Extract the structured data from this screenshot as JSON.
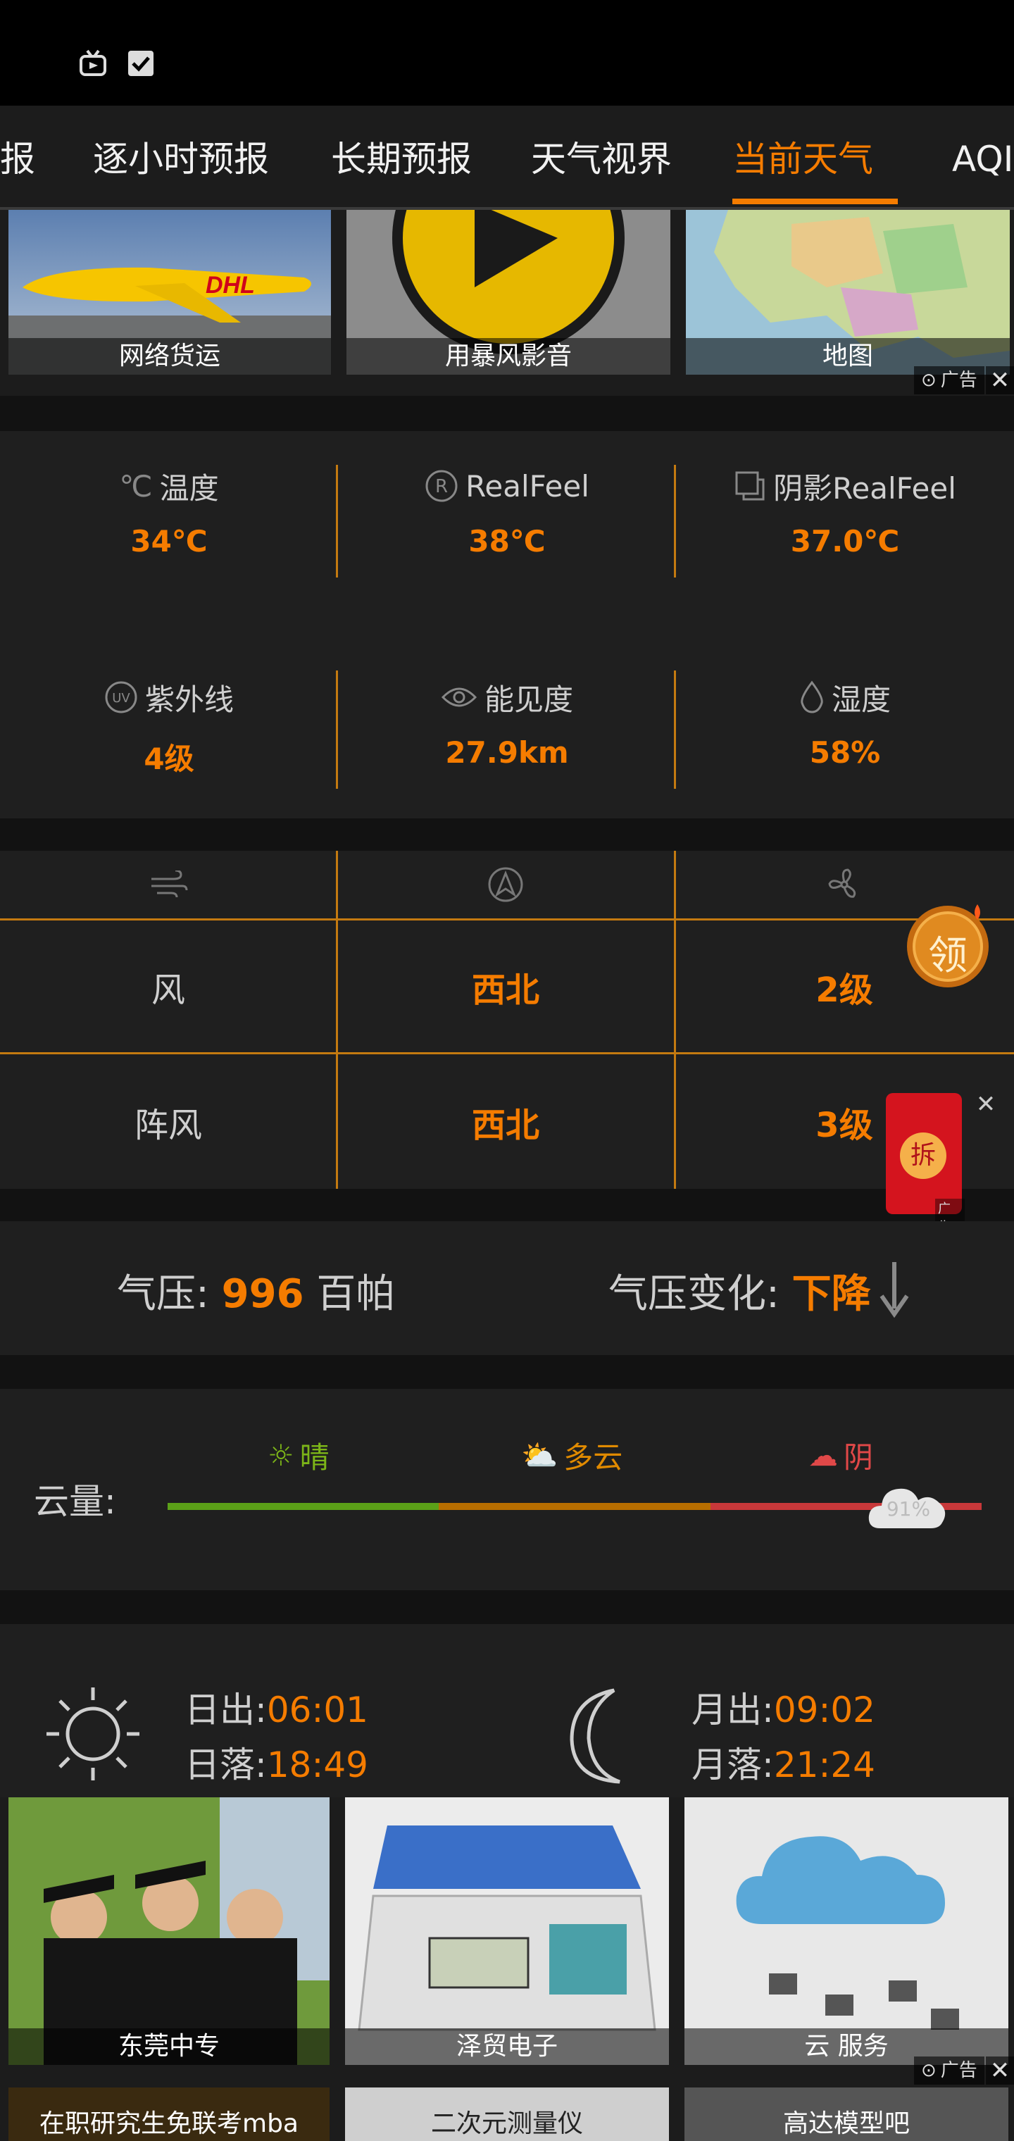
{
  "tabs": [
    "报",
    "逐小时预报",
    "长期预报",
    "天气视界",
    "当前天气",
    "AQI"
  ],
  "active_tab": "当前天气",
  "ads_top": {
    "tiles": [
      "网络货运",
      "用暴风影音",
      "地图"
    ],
    "badge": "广告"
  },
  "metrics": {
    "temperature": {
      "label": "温度",
      "value": "34℃"
    },
    "realfeel": {
      "label": "RealFeel",
      "value": "38℃"
    },
    "shade_realfeel": {
      "label": "阴影RealFeel",
      "value": "37.0℃"
    },
    "uv": {
      "label": "紫外线",
      "value": "4级"
    },
    "visibility": {
      "label": "能见度",
      "value": "27.9km"
    },
    "humidity": {
      "label": "湿度",
      "value": "58%"
    }
  },
  "wind": {
    "rows": [
      {
        "label": "风",
        "direction": "西北",
        "level": "2级"
      },
      {
        "label": "阵风",
        "direction": "西北",
        "level": "3级"
      }
    ],
    "floating_coin": "领",
    "red_packet": "拆",
    "red_packet_badge": "广告"
  },
  "pressure": {
    "label": "气压: ",
    "value": "996",
    "unit": " 百帕",
    "change_label": "气压变化: ",
    "change_value": "下降"
  },
  "cloud": {
    "label": "云量:",
    "levels": [
      "晴",
      "多云",
      "阴"
    ],
    "value": "91%",
    "value_fraction": 0.91
  },
  "sun_moon": {
    "sunrise_label": "日出:",
    "sunrise": "06:01",
    "sunset_label": "日落:",
    "sunset": "18:49",
    "moonrise_label": "月出:",
    "moonrise": "09:02",
    "moonset_label": "月落:",
    "moonset": "21:24"
  },
  "ads_bottom": {
    "tiles": [
      "东莞中专",
      "泽贸电子",
      "云 服务"
    ],
    "badge": "广告",
    "next_tiles": [
      "在职研究生免联考mba",
      "二次元测量仪",
      "高达模型吧"
    ]
  },
  "colors": {
    "accent": "#f57c00",
    "divider": "#c47a10",
    "sunny": "#7cb518",
    "cloudy": "#e08a00",
    "overcast": "#e04848"
  }
}
